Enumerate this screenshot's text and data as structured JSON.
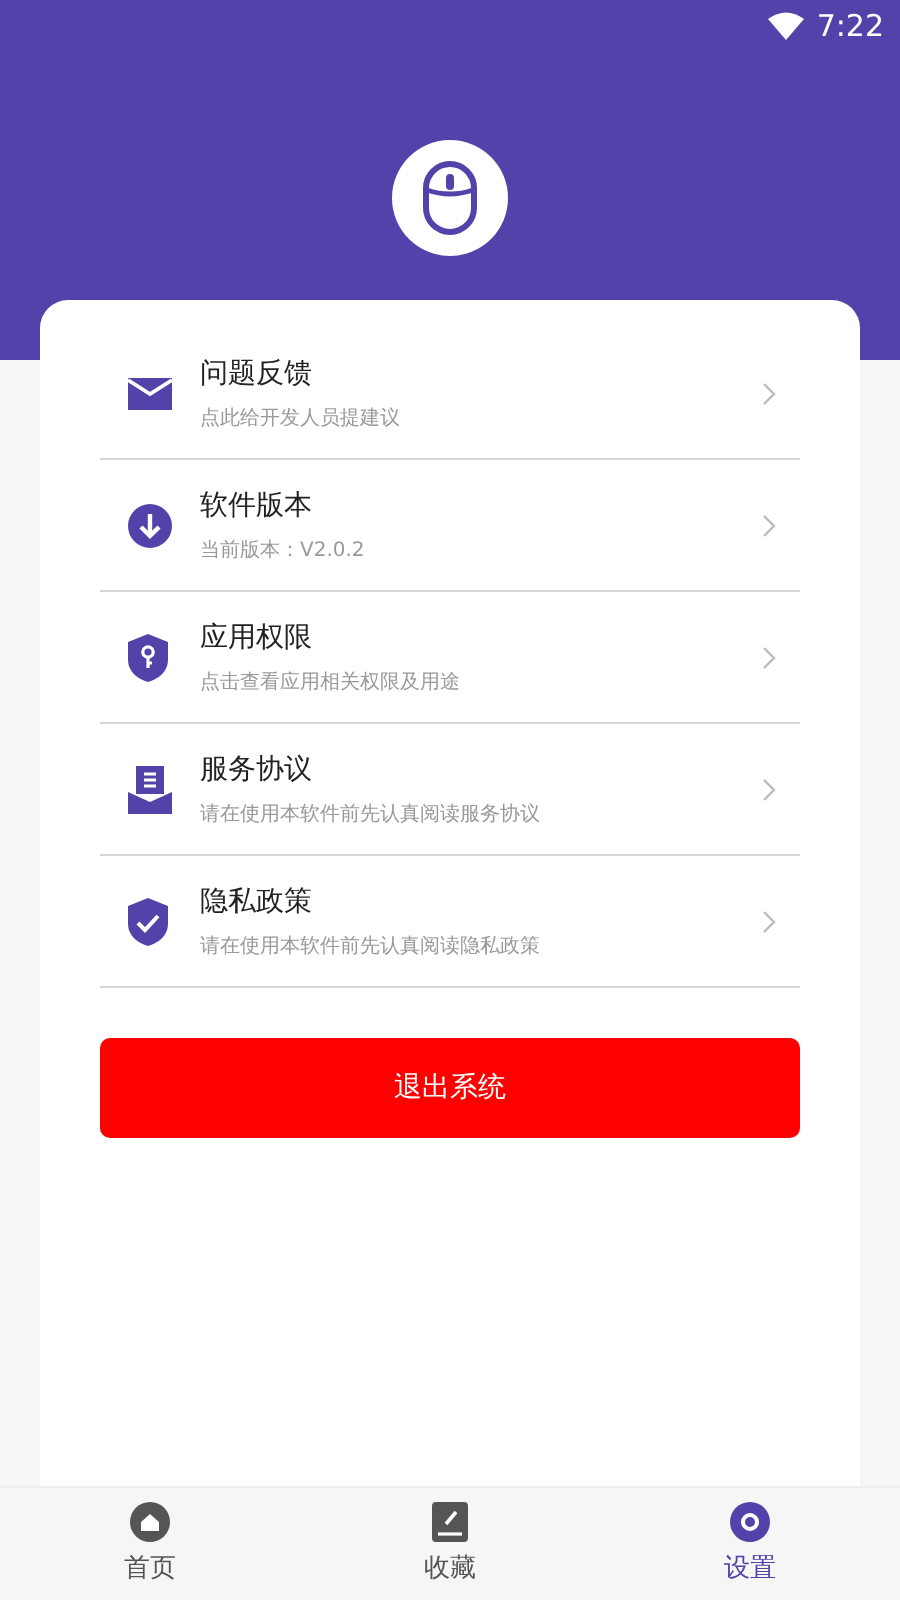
{
  "status_bar": {
    "time": "7:22"
  },
  "settings": [
    {
      "title": "问题反馈",
      "subtitle": "点此给开发人员提建议"
    },
    {
      "title": "软件版本",
      "subtitle": "当前版本：V2.0.2"
    },
    {
      "title": "应用权限",
      "subtitle": "点击查看应用相关权限及用途"
    },
    {
      "title": "服务协议",
      "subtitle": "请在使用本软件前先认真阅读服务协议"
    },
    {
      "title": "隐私政策",
      "subtitle": "请在使用本软件前先认真阅读隐私政策"
    }
  ],
  "logout_button": "退出系统",
  "bottom_nav": [
    {
      "label": "首页",
      "selected": false
    },
    {
      "label": "收藏",
      "selected": false
    },
    {
      "label": "设置",
      "selected": true
    }
  ]
}
